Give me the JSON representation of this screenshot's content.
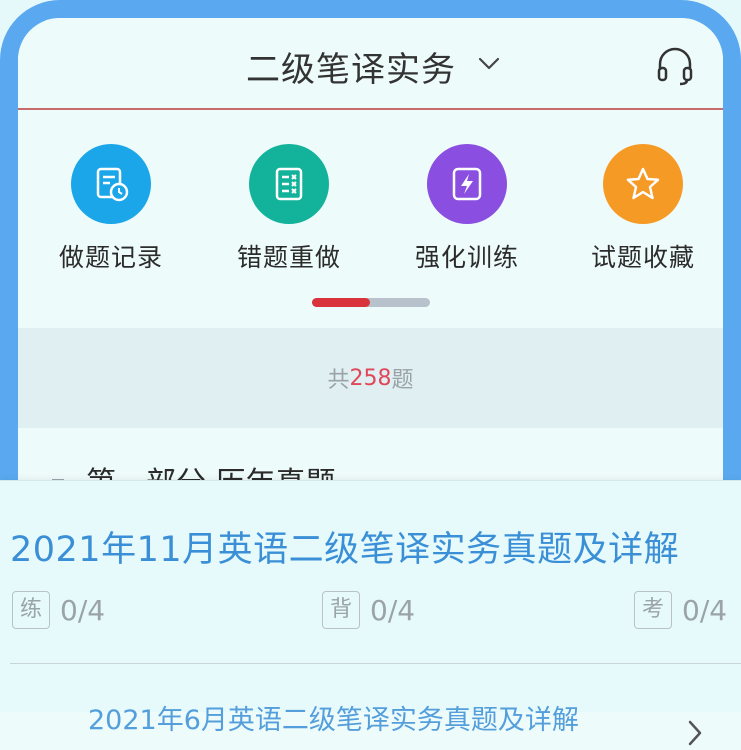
{
  "header": {
    "title": "二级笔译实务"
  },
  "menu": [
    {
      "label": "做题记录",
      "color": "#1aa6e8",
      "icon": "history-doc-icon"
    },
    {
      "label": "错题重做",
      "color": "#13b29a",
      "icon": "wrong-list-icon"
    },
    {
      "label": "强化训练",
      "color": "#8a4fe0",
      "icon": "lightning-icon"
    },
    {
      "label": "试题收藏",
      "color": "#f59a25",
      "icon": "star-icon"
    }
  ],
  "summary": {
    "prefix": "共",
    "count": "258",
    "suffix": "题"
  },
  "section": {
    "title": "第一部分   历年真题"
  },
  "exam": {
    "title": "2021年11月英语二级笔译实务真题及详解",
    "stats": [
      {
        "tag": "练",
        "value": "0/4"
      },
      {
        "tag": "背",
        "value": "0/4"
      },
      {
        "tag": "考",
        "value": "0/4"
      }
    ]
  },
  "next_exam": {
    "title": "2021年6月英语二级笔译实务真题及详解"
  },
  "colors": {
    "accent_red": "#d9333c",
    "link_blue": "#3a8fd6",
    "frame": "#5aa9f0"
  }
}
